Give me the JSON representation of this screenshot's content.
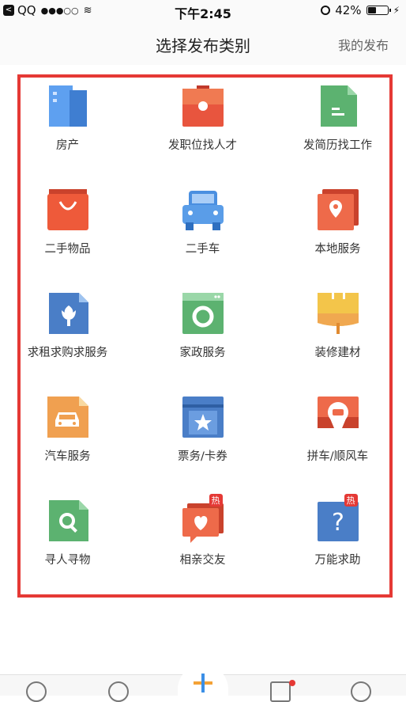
{
  "status_bar": {
    "carrier": "QQ",
    "signal": "●●●○○",
    "time": "下午2:45",
    "battery_percent": "42%",
    "battery_level": 0.42
  },
  "header": {
    "title": "选择发布类别",
    "my_posts": "我的发布"
  },
  "categories": [
    {
      "label": "房产",
      "icon": "building-icon"
    },
    {
      "label": "发职位找人才",
      "icon": "briefcase-icon"
    },
    {
      "label": "发简历找工作",
      "icon": "resume-icon"
    },
    {
      "label": "二手物品",
      "icon": "shopping-bag-icon"
    },
    {
      "label": "二手车",
      "icon": "car-icon"
    },
    {
      "label": "本地服务",
      "icon": "location-pin-icon"
    },
    {
      "label": "求租求购求服务",
      "icon": "flower-doc-icon"
    },
    {
      "label": "家政服务",
      "icon": "appliance-icon"
    },
    {
      "label": "装修建材",
      "icon": "paint-roller-icon"
    },
    {
      "label": "汽车服务",
      "icon": "car-doc-icon"
    },
    {
      "label": "票务/卡券",
      "icon": "ticket-star-icon"
    },
    {
      "label": "拼车/顺风车",
      "icon": "carpool-pin-icon"
    },
    {
      "label": "寻人寻物",
      "icon": "search-doc-icon"
    },
    {
      "label": "相亲交友",
      "icon": "heart-chat-icon",
      "badge": "热"
    },
    {
      "label": "万能求助",
      "icon": "question-icon",
      "badge": "热"
    }
  ],
  "colors": {
    "highlight_frame": "#e53935",
    "blue": "#4a8fe0",
    "red": "#e8553e",
    "green": "#5cb270",
    "yellow": "#f3c54a",
    "orange": "#f0a050"
  }
}
